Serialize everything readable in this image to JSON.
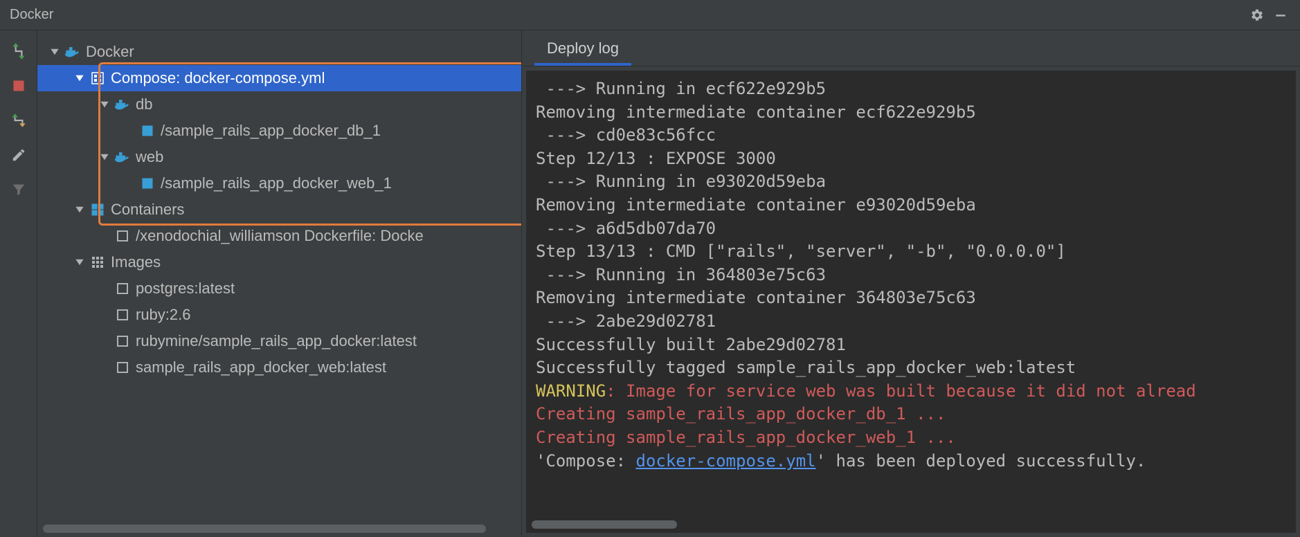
{
  "titlebar": {
    "title": "Docker"
  },
  "toolbar": {
    "items": [
      "deploy",
      "stop",
      "redeploy",
      "edit",
      "filter"
    ]
  },
  "tree": {
    "root": {
      "label": "Docker",
      "expanded": true,
      "compose": {
        "label": "Compose: docker-compose.yml",
        "expanded": true,
        "services": [
          {
            "label": "db",
            "expanded": true,
            "containers": [
              {
                "label": "/sample_rails_app_docker_db_1",
                "running": true
              }
            ]
          },
          {
            "label": "web",
            "expanded": true,
            "containers": [
              {
                "label": "/sample_rails_app_docker_web_1",
                "running": true
              }
            ]
          }
        ]
      },
      "containers": {
        "label": "Containers",
        "expanded": true,
        "items": [
          {
            "label": "/xenodochial_williamson Dockerfile: Docke",
            "running": false
          }
        ]
      },
      "images": {
        "label": "Images",
        "expanded": true,
        "items": [
          {
            "label": "postgres:latest"
          },
          {
            "label": "ruby:2.6"
          },
          {
            "label": "rubymine/sample_rails_app_docker:latest"
          },
          {
            "label": "sample_rails_app_docker_web:latest"
          }
        ]
      }
    }
  },
  "tabs": {
    "items": [
      {
        "label": "Deploy log",
        "active": true
      }
    ]
  },
  "log": {
    "lines": [
      {
        "text": " ---> Running in ecf622e929b5"
      },
      {
        "text": "Removing intermediate container ecf622e929b5"
      },
      {
        "text": " ---> cd0e83c56fcc"
      },
      {
        "text": "Step 12/13 : EXPOSE 3000"
      },
      {
        "text": " ---> Running in e93020d59eba"
      },
      {
        "text": "Removing intermediate container e93020d59eba"
      },
      {
        "text": " ---> a6d5db07da70"
      },
      {
        "text": "Step 13/13 : CMD [\"rails\", \"server\", \"-b\", \"0.0.0.0\"]"
      },
      {
        "text": " ---> Running in 364803e75c63"
      },
      {
        "text": "Removing intermediate container 364803e75c63"
      },
      {
        "text": " ---> 2abe29d02781"
      },
      {
        "text": "Successfully built 2abe29d02781"
      },
      {
        "text": "Successfully tagged sample_rails_app_docker_web:latest"
      },
      {
        "segments": [
          {
            "text": "WARNING",
            "cls": "w-yellow"
          },
          {
            "text": ": Image for service web was built because it did not alread",
            "cls": "w-red"
          }
        ]
      },
      {
        "segments": [
          {
            "text": "Creating sample_rails_app_docker_db_1 ...",
            "cls": "w-red"
          }
        ]
      },
      {
        "segments": [
          {
            "text": "Creating sample_rails_app_docker_web_1 ...",
            "cls": "w-red"
          }
        ]
      },
      {
        "segments": [
          {
            "text": "'Compose: "
          },
          {
            "text": "docker-compose.yml",
            "cls": "w-blue"
          },
          {
            "text": "' has been deployed successfully."
          }
        ]
      }
    ]
  },
  "colors": {
    "selected": "#2f65ca",
    "highlight_border": "#e07c3e",
    "warning": "#d6c35a",
    "error": "#d05a5a",
    "link": "#5394ec"
  }
}
